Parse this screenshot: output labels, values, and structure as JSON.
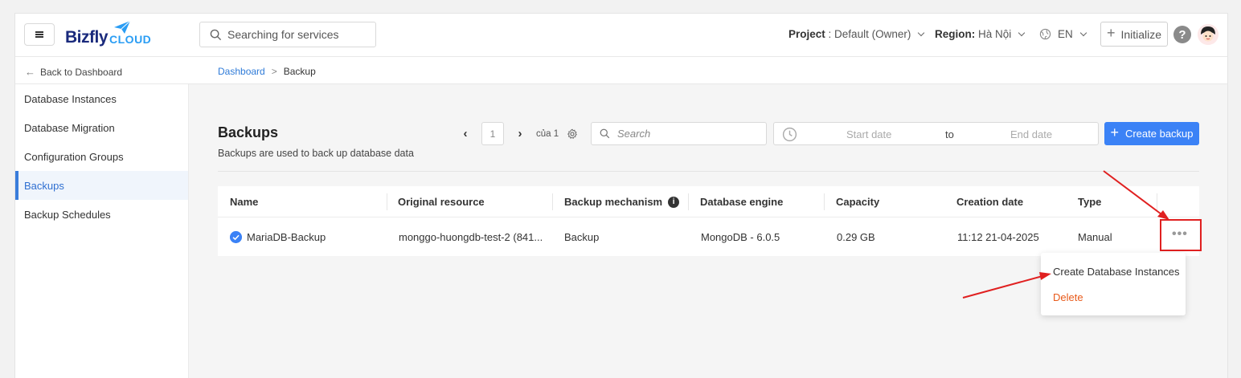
{
  "header": {
    "logo_main": "Bizfly",
    "logo_sub": "CLOUD",
    "search_placeholder": "Searching for services",
    "project_label": "Project",
    "project_value": ": Default (Owner)",
    "region_label": "Region:",
    "region_value": "Hà Nội",
    "language": "EN",
    "initialize_label": "Initialize",
    "help_label": "?"
  },
  "subbar": {
    "back_label": "Back to Dashboard",
    "breadcrumb": [
      "Dashboard",
      "Backup"
    ],
    "breadcrumb_sep": ">"
  },
  "sidebar": {
    "items": [
      {
        "label": "Database Instances",
        "active": false
      },
      {
        "label": "Database Migration",
        "active": false
      },
      {
        "label": "Configuration Groups",
        "active": false
      },
      {
        "label": "Backups",
        "active": true
      },
      {
        "label": "Backup Schedules",
        "active": false
      }
    ]
  },
  "main": {
    "title": "Backups",
    "subtitle": "Backups are used to back up database data",
    "pager": {
      "current": "1",
      "of_label": "của 1"
    },
    "search_placeholder": "Search",
    "date_start": "Start date",
    "date_to": "to",
    "date_end": "End date",
    "create_label": "Create backup"
  },
  "table": {
    "columns": [
      "Name",
      "Original resource",
      "Backup mechanism",
      "Database engine",
      "Capacity",
      "Creation date",
      "Type"
    ],
    "rows": [
      {
        "name": "MariaDB-Backup",
        "original_resource": "monggo-huongdb-test-2 (841...",
        "mechanism": "Backup",
        "engine": "MongoDB - 6.0.5",
        "capacity": "0.29 GB",
        "created": "11:12 21-04-2025",
        "type": "Manual"
      }
    ]
  },
  "dropdown": {
    "create_label": "Create Database Instances",
    "delete_label": "Delete"
  },
  "colors": {
    "accent": "#3b82f6",
    "danger": "#e85a1a",
    "annotation": "#e02020"
  }
}
